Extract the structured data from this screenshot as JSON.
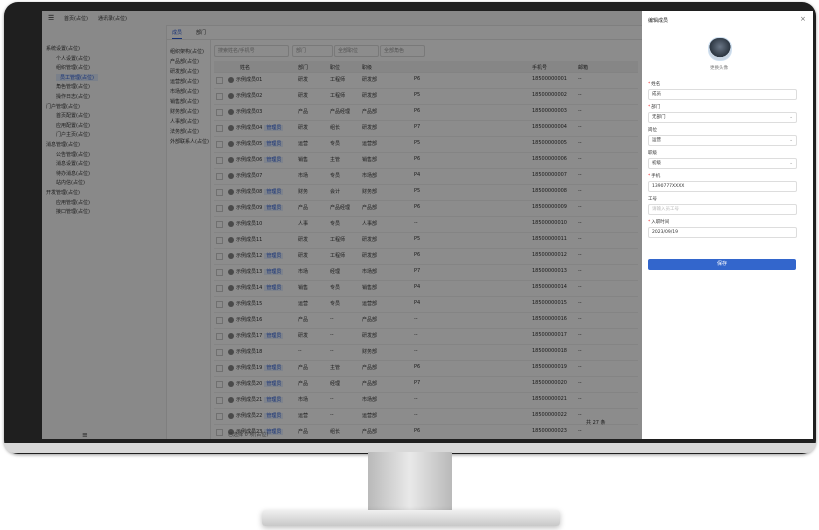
{
  "window": {
    "crumbs": [
      "首页(占位)",
      "通讯录(占位)"
    ]
  },
  "sidebar": {
    "items": [
      {
        "label": "系统设置(占位)",
        "active": false
      },
      {
        "label": "个人设置(占位)",
        "active": false
      },
      {
        "label": "组织管理(占位)",
        "active": false
      },
      {
        "label": "员工管理(占位)",
        "active": true
      },
      {
        "label": "角色管理(占位)",
        "active": false
      },
      {
        "label": "操作日志(占位)",
        "active": false
      },
      {
        "label": "门户管理(占位)",
        "active": false
      },
      {
        "label": "首页配置(占位)",
        "active": false
      },
      {
        "label": "应用配置(占位)",
        "active": false
      },
      {
        "label": "门户主页(占位)",
        "active": false
      },
      {
        "label": "消息管理(占位)",
        "active": false
      },
      {
        "label": "公告管理(占位)",
        "active": false
      },
      {
        "label": "消息设置(占位)",
        "active": false
      },
      {
        "label": "待办消息(占位)",
        "active": false
      },
      {
        "label": "站内信(占位)",
        "active": false
      },
      {
        "label": "开发管理(占位)",
        "active": false
      },
      {
        "label": "应用管理(占位)",
        "active": false
      },
      {
        "label": "接口管理(占位)",
        "active": false
      }
    ]
  },
  "main": {
    "tabs": [
      "成员",
      "部门"
    ],
    "tree": [
      "组织架构(占位)",
      "产品部(占位)",
      "研发部(占位)",
      "运营部(占位)",
      "市场部(占位)",
      "销售部(占位)",
      "财务部(占位)",
      "人事部(占位)",
      "法务部(占位)",
      "外部联系人(占位)"
    ],
    "filters": [
      "搜索姓名/手机号",
      "部门",
      "全部职位",
      "全部角色"
    ],
    "columns": [
      "姓名",
      "部门",
      "职位",
      "职级",
      "手机号",
      "邮箱"
    ],
    "rows": [
      {
        "name": "示例成员01",
        "tag": "",
        "dept": "研发",
        "title": "工程师",
        "level": "P6",
        "note": "研发部",
        "phone": "18500000001",
        "mail": "--"
      },
      {
        "name": "示例成员02",
        "tag": "",
        "dept": "研发",
        "title": "工程师",
        "level": "P5",
        "note": "研发部",
        "phone": "18500000002",
        "mail": "--"
      },
      {
        "name": "示例成员03",
        "tag": "",
        "dept": "产品",
        "title": "产品经理",
        "level": "P6",
        "note": "产品部",
        "phone": "18500000003",
        "mail": "--"
      },
      {
        "name": "示例成员04",
        "tag": "管理员",
        "dept": "研发",
        "title": "组长",
        "level": "P7",
        "note": "研发部",
        "phone": "18500000004",
        "mail": "--"
      },
      {
        "name": "示例成员05",
        "tag": "管理员",
        "dept": "运营",
        "title": "专员",
        "level": "P5",
        "note": "运营部",
        "phone": "18500000005",
        "mail": "--"
      },
      {
        "name": "示例成员06",
        "tag": "管理员",
        "dept": "销售",
        "title": "主管",
        "level": "P6",
        "note": "销售部",
        "phone": "18500000006",
        "mail": "--"
      },
      {
        "name": "示例成员07",
        "tag": "",
        "dept": "市场",
        "title": "专员",
        "level": "P4",
        "note": "市场部",
        "phone": "18500000007",
        "mail": "--"
      },
      {
        "name": "示例成员08",
        "tag": "管理员",
        "dept": "财务",
        "title": "会计",
        "level": "P5",
        "note": "财务部",
        "phone": "18500000008",
        "mail": "--"
      },
      {
        "name": "示例成员09",
        "tag": "管理员",
        "dept": "产品",
        "title": "产品经理",
        "level": "P6",
        "note": "产品部",
        "phone": "18500000009",
        "mail": "--"
      },
      {
        "name": "示例成员10",
        "tag": "",
        "dept": "人事",
        "title": "专员",
        "level": "--",
        "note": "人事部",
        "phone": "18500000010",
        "mail": "--"
      },
      {
        "name": "示例成员11",
        "tag": "",
        "dept": "研发",
        "title": "工程师",
        "level": "P5",
        "note": "研发部",
        "phone": "18500000011",
        "mail": "--"
      },
      {
        "name": "示例成员12",
        "tag": "管理员",
        "dept": "研发",
        "title": "工程师",
        "level": "P6",
        "note": "研发部",
        "phone": "18500000012",
        "mail": "--"
      },
      {
        "name": "示例成员13",
        "tag": "管理员",
        "dept": "市场",
        "title": "经理",
        "level": "P7",
        "note": "市场部",
        "phone": "18500000013",
        "mail": "--"
      },
      {
        "name": "示例成员14",
        "tag": "管理员",
        "dept": "销售",
        "title": "专员",
        "level": "P4",
        "note": "销售部",
        "phone": "18500000014",
        "mail": "--"
      },
      {
        "name": "示例成员15",
        "tag": "",
        "dept": "运营",
        "title": "专员",
        "level": "P4",
        "note": "运营部",
        "phone": "18500000015",
        "mail": "--"
      },
      {
        "name": "示例成员16",
        "tag": "",
        "dept": "产品",
        "title": "--",
        "level": "--",
        "note": "产品部",
        "phone": "18500000016",
        "mail": "--"
      },
      {
        "name": "示例成员17",
        "tag": "管理员",
        "dept": "研发",
        "title": "--",
        "level": "--",
        "note": "研发部",
        "phone": "18500000017",
        "mail": "--"
      },
      {
        "name": "示例成员18",
        "tag": "",
        "dept": "--",
        "title": "--",
        "level": "--",
        "note": "财务部",
        "phone": "18500000018",
        "mail": "--"
      },
      {
        "name": "示例成员19",
        "tag": "管理员",
        "dept": "产品",
        "title": "主管",
        "level": "P6",
        "note": "产品部",
        "phone": "18500000019",
        "mail": "--"
      },
      {
        "name": "示例成员20",
        "tag": "管理员",
        "dept": "产品",
        "title": "经理",
        "level": "P7",
        "note": "产品部",
        "phone": "18500000020",
        "mail": "--"
      },
      {
        "name": "示例成员21",
        "tag": "管理员",
        "dept": "市场",
        "title": "--",
        "level": "--",
        "note": "市场部",
        "phone": "18500000021",
        "mail": "--"
      },
      {
        "name": "示例成员22",
        "tag": "管理员",
        "dept": "运营",
        "title": "--",
        "level": "--",
        "note": "运营部",
        "phone": "18500000022",
        "mail": "--"
      },
      {
        "name": "示例成员23",
        "tag": "管理员",
        "dept": "产品",
        "title": "组长",
        "level": "P6",
        "note": "产品部",
        "phone": "18500000023",
        "mail": "--"
      },
      {
        "name": "示例成员24",
        "tag": "",
        "dept": "运营",
        "title": "专员",
        "level": "P5",
        "note": "运营部",
        "phone": "18500000024",
        "mail": "--"
      }
    ],
    "pager": "共 27 条",
    "footer": "已选择 0 项(占位)"
  },
  "panel": {
    "title": "编辑成员",
    "close": "×",
    "avatar_caption": "更换头像",
    "fields": [
      {
        "label": "姓名",
        "required": true,
        "value": "成员",
        "select": false,
        "placeholder": false
      },
      {
        "label": "部门",
        "required": true,
        "value": "无部门",
        "select": true,
        "placeholder": false
      },
      {
        "label": "岗位",
        "required": false,
        "value": "运营",
        "select": true,
        "placeholder": false
      },
      {
        "label": "职级",
        "required": false,
        "value": "初级",
        "select": true,
        "placeholder": false
      },
      {
        "label": "手机",
        "required": true,
        "value": "1390777XXXX",
        "select": false,
        "placeholder": false
      },
      {
        "label": "工号",
        "required": false,
        "value": "请输入员工号",
        "select": false,
        "placeholder": true
      },
      {
        "label": "入职时间",
        "required": true,
        "value": "2023/09/19",
        "select": false,
        "placeholder": false
      }
    ],
    "save_label": "保存"
  }
}
